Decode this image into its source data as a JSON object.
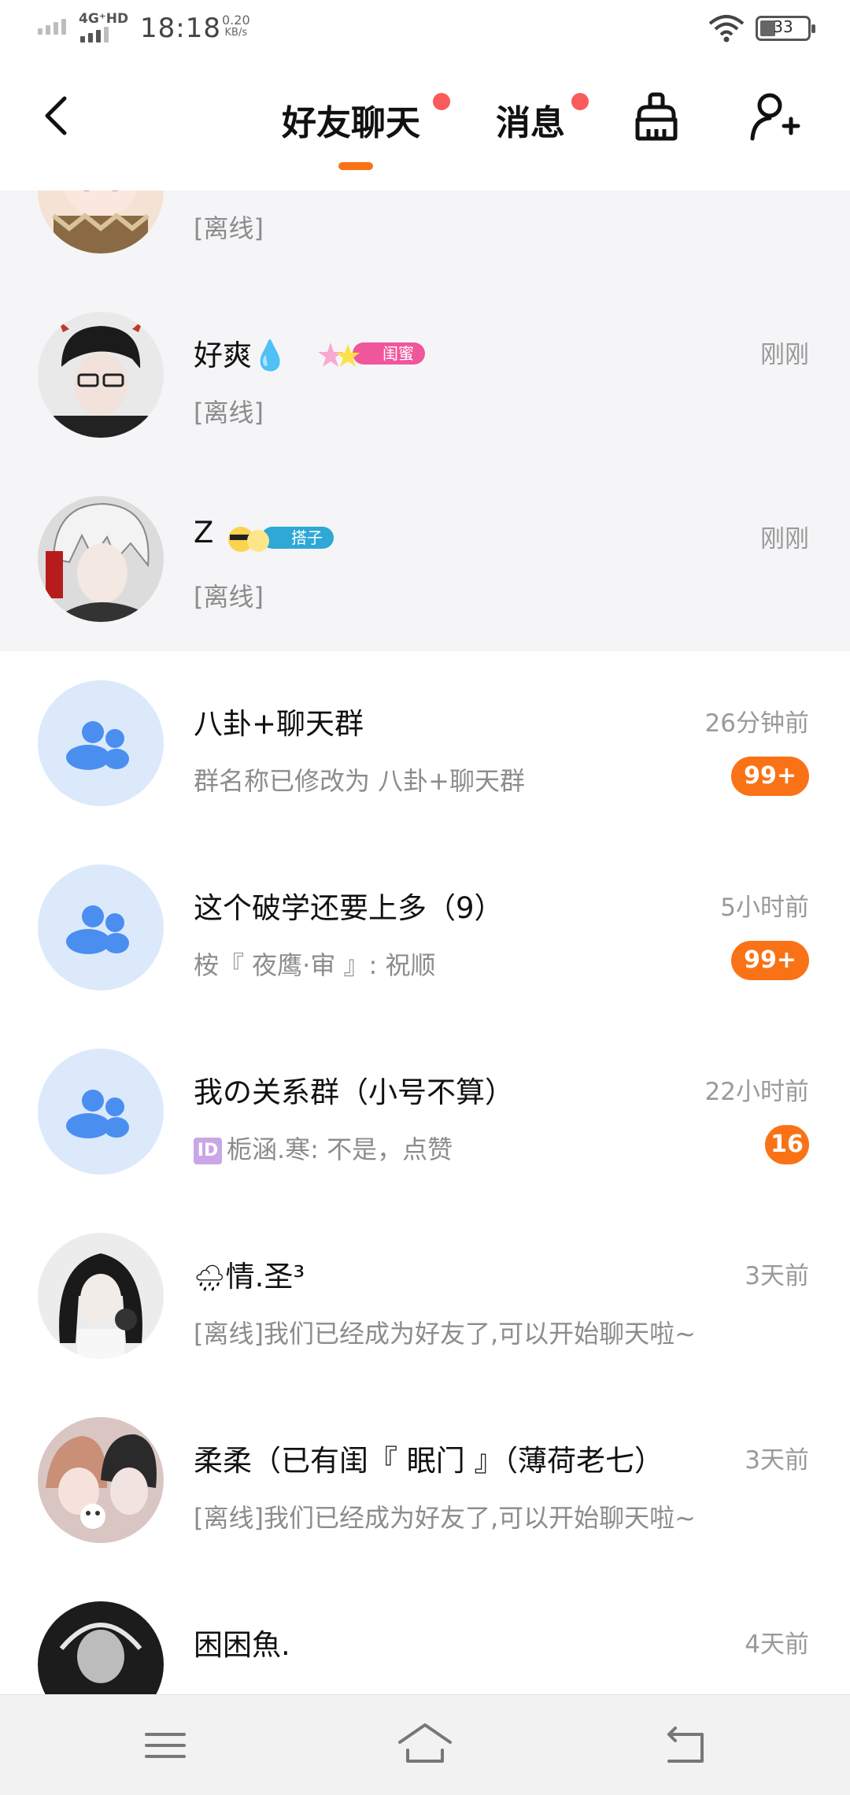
{
  "status_bar": {
    "network": "4G⁺HD",
    "time": "18:18",
    "speed_value": "0.20",
    "speed_unit": "KB/s",
    "battery": "33"
  },
  "header": {
    "tabs": [
      {
        "label": "好友聊天",
        "has_dot": true,
        "active": true
      },
      {
        "label": "消息",
        "has_dot": true,
        "active": false
      }
    ],
    "icons": [
      "back-icon",
      "broom-clean-icon",
      "add-friend-icon"
    ],
    "accent_color": "#f97316",
    "dot_color": "#fb5b5b"
  },
  "chats": [
    {
      "name": "",
      "message": "[离线]",
      "time": "",
      "badge": "",
      "type": "person",
      "status": "offline"
    },
    {
      "name": "好爽💧",
      "tag": "闺蜜",
      "tag_color": "#f0569b",
      "message": "[离线]",
      "time": "刚刚",
      "badge": "",
      "type": "person"
    },
    {
      "name": "Z",
      "tag": "搭子",
      "tag_color": "#2ea8d6",
      "message": "[离线]",
      "time": "刚刚",
      "badge": "",
      "type": "person"
    },
    {
      "name": "八卦+聊天群",
      "message": "群名称已修改为 八卦+聊天群",
      "time": "26分钟前",
      "badge": "99+",
      "type": "group"
    },
    {
      "name": "这个破学还要上多（9）",
      "message": "桉『 夜鹰·审 』: 祝顺",
      "time": "5小时前",
      "badge": "99+",
      "type": "group"
    },
    {
      "name": "我の关系群（小号不算）",
      "message": "栀涵.寒: 不是，点赞",
      "id_chip": "ID",
      "time": "22小时前",
      "badge": "16",
      "type": "group"
    },
    {
      "name": "情.圣³",
      "name_prefix_icon": "cloud-rain-icon",
      "message": "[离线]我们已经成为好友了,可以开始聊天啦~",
      "time": "3天前",
      "badge": "",
      "type": "person"
    },
    {
      "name": "柔柔（已有闺『 眠门 』（薄荷老七）",
      "message": "[离线]我们已经成为好友了,可以开始聊天啦~",
      "time": "3天前",
      "badge": "",
      "type": "person"
    },
    {
      "name": "困困魚.",
      "message": "",
      "time": "4天前",
      "badge": "",
      "type": "person"
    }
  ],
  "navbar": {
    "icons": [
      "menu-icon",
      "home-icon",
      "back-nav-icon"
    ]
  }
}
